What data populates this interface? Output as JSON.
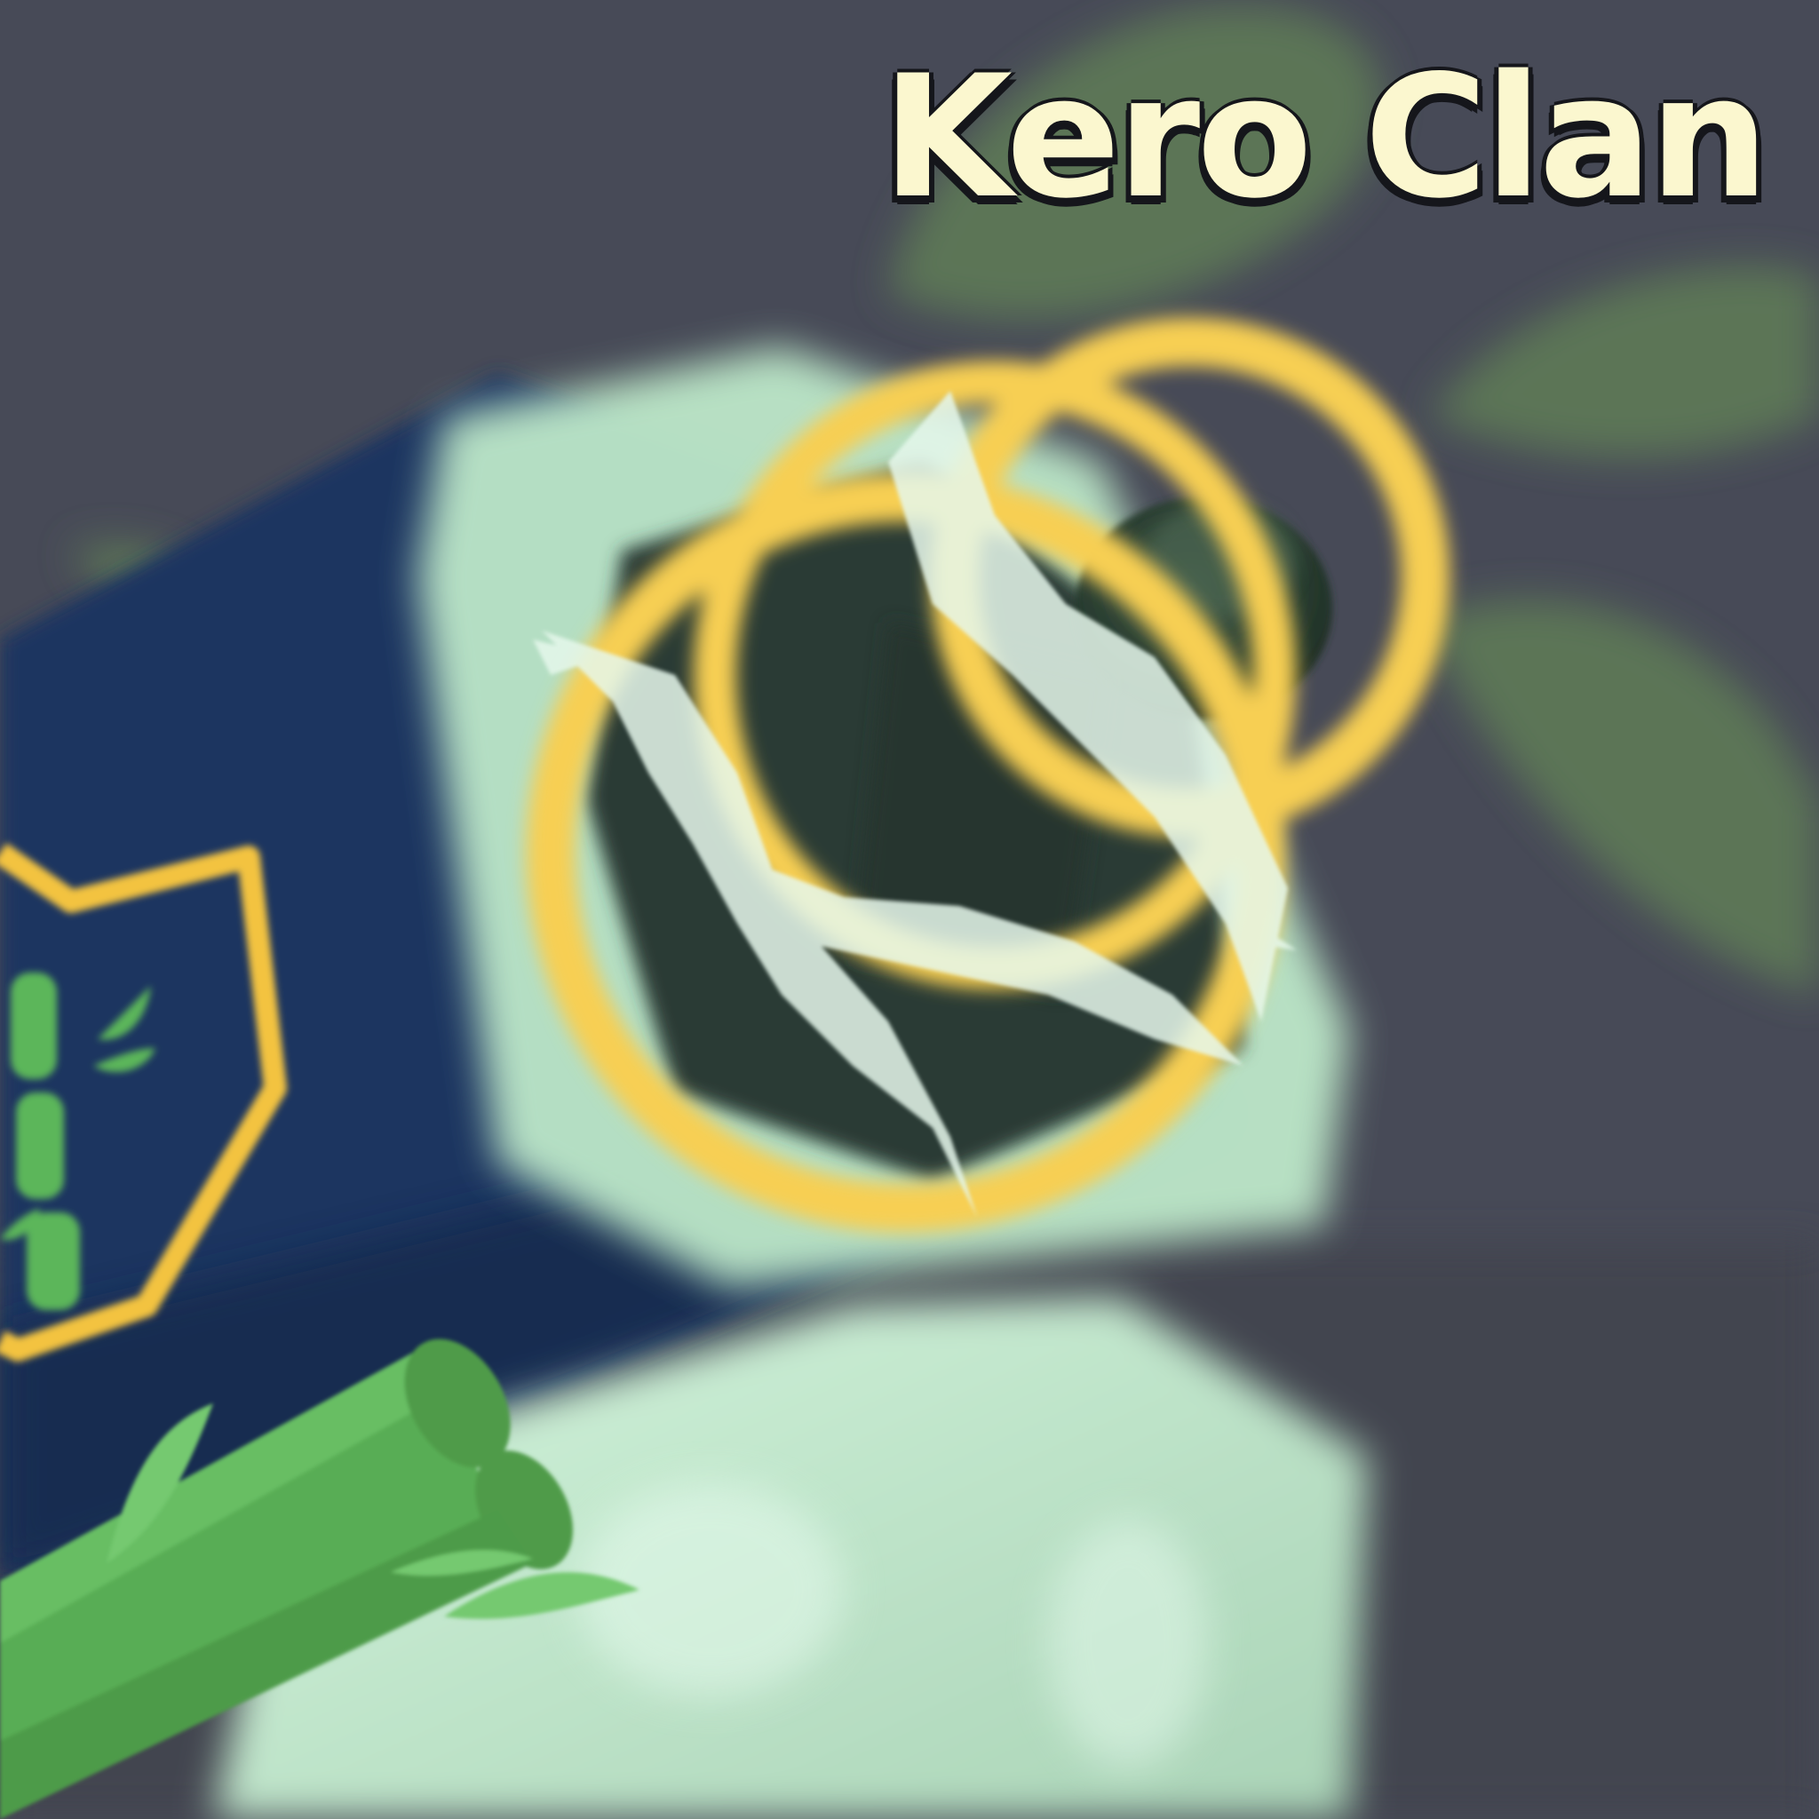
{
  "title": "Kero Clan",
  "colors": {
    "background": "#474a57",
    "leaf": "#5c7556",
    "cannon_body": "#1e3560",
    "cannon_rim": "#bde8c9",
    "ring": "#f7cf52",
    "badge_outline": "#f3c340",
    "bamboo": "#5cb65a",
    "base_block": "#c5ecd0",
    "title_text": "#fbf7cf",
    "title_outline": "#15161b"
  },
  "icons": [
    "leaf-shape",
    "cannon",
    "clan-badge-shield",
    "bamboo-emblem",
    "bamboo-log",
    "lightning-spark",
    "cannonball"
  ]
}
